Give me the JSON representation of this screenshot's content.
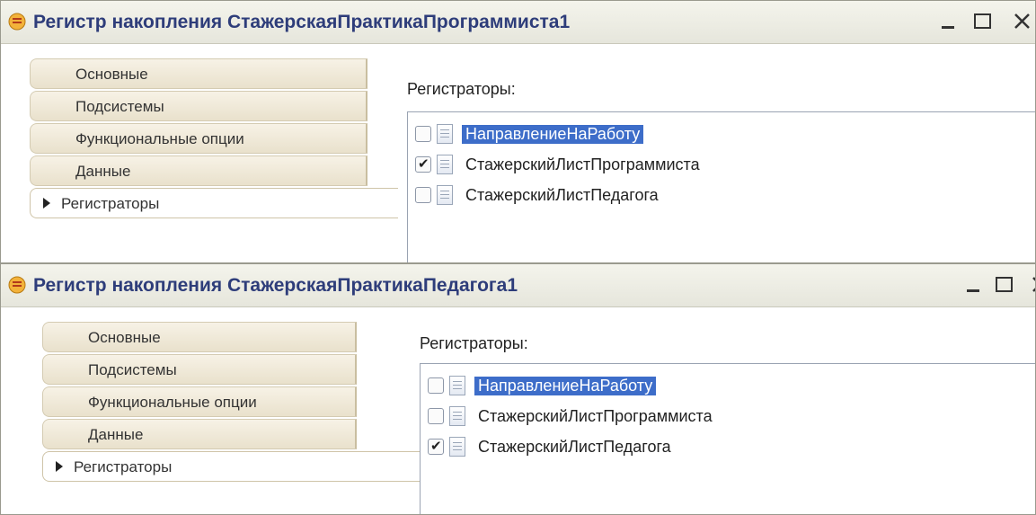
{
  "windows": [
    {
      "title": "Регистр накопления СтажерскаяПрактикаПрограммиста1",
      "tabs": [
        "Основные",
        "Подсистемы",
        "Функциональные опции",
        "Данные",
        "Регистраторы"
      ],
      "active_tab": "Регистраторы",
      "panel_label": "Регистраторы:",
      "registrars": [
        {
          "name": "НаправлениеНаРаботу",
          "checked": false,
          "selected": true
        },
        {
          "name": "СтажерскийЛистПрограммиста",
          "checked": true,
          "selected": false
        },
        {
          "name": "СтажерскийЛистПедагога",
          "checked": false,
          "selected": false
        }
      ]
    },
    {
      "title": "Регистр накопления СтажерскаяПрактикаПедагога1",
      "tabs": [
        "Основные",
        "Подсистемы",
        "Функциональные опции",
        "Данные",
        "Регистраторы"
      ],
      "active_tab": "Регистраторы",
      "panel_label": "Регистраторы:",
      "registrars": [
        {
          "name": "НаправлениеНаРаботу",
          "checked": false,
          "selected": true
        },
        {
          "name": "СтажерскийЛистПрограммиста",
          "checked": false,
          "selected": false
        },
        {
          "name": "СтажерскийЛистПедагога",
          "checked": true,
          "selected": false
        }
      ]
    }
  ],
  "icons": {
    "app": "register-icon",
    "minimize": "minimize-icon",
    "maximize": "maximize-icon",
    "close": "close-icon",
    "document": "document-icon",
    "active_tab_marker": "triangle-right-icon"
  },
  "colors": {
    "title_text": "#2e3d7a",
    "selection": "#3d6dc9",
    "tab_bg": "#efe8d6"
  }
}
